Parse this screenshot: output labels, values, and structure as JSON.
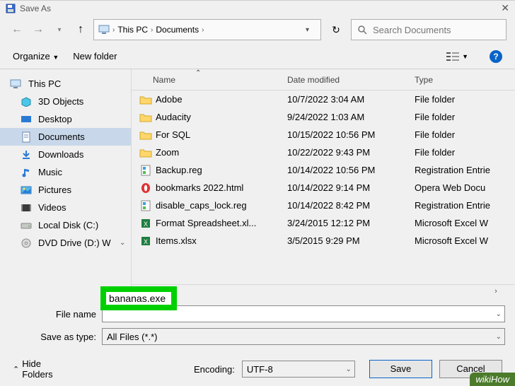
{
  "title": "Save As",
  "nav": {
    "breadcrumb": [
      "This PC",
      "Documents"
    ],
    "search_placeholder": "Search Documents"
  },
  "toolbar": {
    "organize": "Organize",
    "newfolder": "New folder"
  },
  "sidebar": {
    "root": "This PC",
    "items": [
      {
        "label": "3D Objects"
      },
      {
        "label": "Desktop"
      },
      {
        "label": "Documents"
      },
      {
        "label": "Downloads"
      },
      {
        "label": "Music"
      },
      {
        "label": "Pictures"
      },
      {
        "label": "Videos"
      },
      {
        "label": "Local Disk (C:)"
      },
      {
        "label": "DVD Drive (D:) W"
      }
    ]
  },
  "columns": {
    "name": "Name",
    "date": "Date modified",
    "type": "Type"
  },
  "files": [
    {
      "icon": "folder",
      "name": "Adobe",
      "date": "10/7/2022 3:04 AM",
      "type": "File folder"
    },
    {
      "icon": "folder",
      "name": "Audacity",
      "date": "9/24/2022 1:03 AM",
      "type": "File folder"
    },
    {
      "icon": "folder",
      "name": "For SQL",
      "date": "10/15/2022 10:56 PM",
      "type": "File folder"
    },
    {
      "icon": "folder",
      "name": "Zoom",
      "date": "10/22/2022 9:43 PM",
      "type": "File folder"
    },
    {
      "icon": "reg",
      "name": "Backup.reg",
      "date": "10/14/2022 10:56 PM",
      "type": "Registration Entrie"
    },
    {
      "icon": "opera",
      "name": "bookmarks 2022.html",
      "date": "10/14/2022 9:14 PM",
      "type": "Opera Web Docu"
    },
    {
      "icon": "reg",
      "name": "disable_caps_lock.reg",
      "date": "10/14/2022 8:42 PM",
      "type": "Registration Entrie"
    },
    {
      "icon": "excel",
      "name": "Format Spreadsheet.xl...",
      "date": "3/24/2015 12:12 PM",
      "type": "Microsoft Excel W"
    },
    {
      "icon": "excel",
      "name": "Items.xlsx",
      "date": "3/5/2015 9:29 PM",
      "type": "Microsoft Excel W"
    }
  ],
  "form": {
    "filename_label": "File name",
    "filename_value": "bananas.exe",
    "savetype_label": "Save as type:",
    "savetype_value": "All Files  (*.*)"
  },
  "footer": {
    "hide": "Hide Folders",
    "encoding_label": "Encoding:",
    "encoding_value": "UTF-8",
    "save": "Save",
    "cancel": "Cancel"
  },
  "watermark": "wikiHow"
}
